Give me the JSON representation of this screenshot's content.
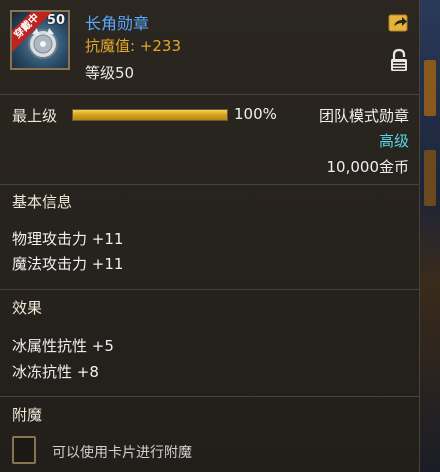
{
  "item": {
    "name": "长角勋章",
    "resist": "抗魔值: +233",
    "level": "等级50",
    "icon_level": "50",
    "equipped_badge": "穿戴中",
    "icon": "medal-icon"
  },
  "icons": {
    "share": "share-icon",
    "lock": "lock-icon"
  },
  "rarity": {
    "label": "最上级",
    "progress_text": "100%",
    "progress_fraction": 1.0
  },
  "info": {
    "type": "团队模式勋章",
    "grade": "高级",
    "price": "10,000金币"
  },
  "sections": {
    "basic_title": "基本信息",
    "basic_stats": [
      "物理攻击力 +11",
      "魔法攻击力 +11"
    ],
    "effect_title": "效果",
    "effect_stats": [
      "冰属性抗性 +5",
      "冰冻抗性 +8"
    ],
    "enchant_title": "附魔",
    "enchant_hint": "可以使用卡片进行附魔"
  },
  "colors": {
    "item_name": "#5aa8ff",
    "resist": "#e0a82c",
    "grade": "#5ad6e8",
    "progress": "#f4d35a",
    "badge": "#c0221e"
  }
}
